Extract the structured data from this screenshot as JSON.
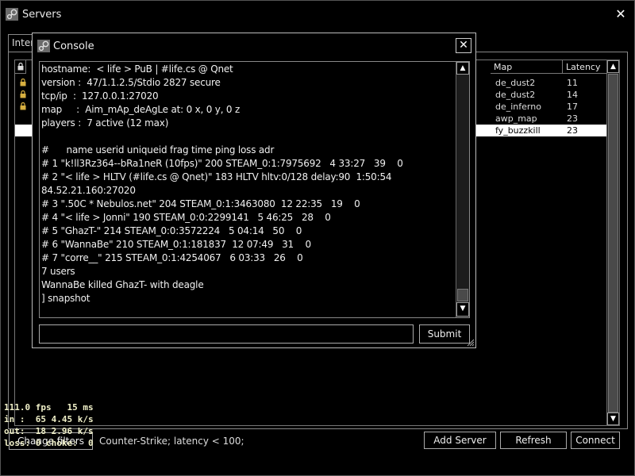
{
  "window": {
    "title": "Servers"
  },
  "tabs": [
    {
      "label": "Inter"
    }
  ],
  "server_list": {
    "columns": {
      "map": "Map",
      "latency": "Latency"
    },
    "rows": [
      {
        "map": "de_dust2",
        "latency": "11",
        "locked": true,
        "selected": false
      },
      {
        "map": "de_dust2",
        "latency": "14",
        "locked": true,
        "selected": false
      },
      {
        "map": "de_inferno",
        "latency": "17",
        "locked": true,
        "selected": false
      },
      {
        "map": "awp_map",
        "latency": "23",
        "locked": false,
        "selected": false
      },
      {
        "map": "fy_buzzkill",
        "latency": "23",
        "locked": false,
        "selected": true
      }
    ]
  },
  "bottom_bar": {
    "change_filters": "Change filters",
    "filter_text": "Counter-Strike; latency < 100;",
    "add_server": "Add Server",
    "refresh": "Refresh",
    "connect": "Connect"
  },
  "netgraph": {
    "line1": "111.0 fps   15 ms",
    "line2": "in :  65 4.45 k/s",
    "line3": "out:  18 2.96 k/s",
    "line4": "loss: 0 choke:  0"
  },
  "console": {
    "title": "Console",
    "lines": [
      "hostname:  < life > PuB | #life.cs @ Qnet",
      "version :  47/1.1.2.5/Stdio 2827 secure",
      "tcp/ip  :  127.0.0.1:27020",
      "map     :  Aim_mAp_deAgLe at: 0 x, 0 y, 0 z",
      "players :  7 active (12 max)",
      "",
      "#      name userid uniqueid frag time ping loss adr",
      "# 1 \"k!ll3Rz364--bRa1neR (10fps)\" 200 STEAM_0:1:7975692   4 33:27   39    0",
      "# 2 \"< life > HLTV (#life.cs @ Qnet)\" 183 HLTV hltv:0/128 delay:90  1:50:54",
      "84.52.21.160:27020",
      "# 3 \".50C * Nebulos.net\" 204 STEAM_0:1:3463080  12 22:35   19    0",
      "# 4 \"< life > Jonni\" 190 STEAM_0:0:2299141   5 46:25   28    0",
      "# 5 \"GhazT-\" 214 STEAM_0:0:3572224   5 04:14   50    0",
      "# 6 \"WannaBe\" 210 STEAM_0:1:181837  12 07:49   31    0",
      "# 7 \"corre__\" 215 STEAM_0:1:4254067   6 03:33   26    0",
      "7 users",
      "WannaBe killed GhazT- with deagle",
      "] snapshot"
    ],
    "input_value": "",
    "submit": "Submit"
  },
  "icons": {
    "app": "steam-icon",
    "lock": "lock-icon",
    "close": "close-icon"
  },
  "colors": {
    "background": "#000000",
    "selection": "#ffffff",
    "netgraph": "#f0f0c8"
  }
}
